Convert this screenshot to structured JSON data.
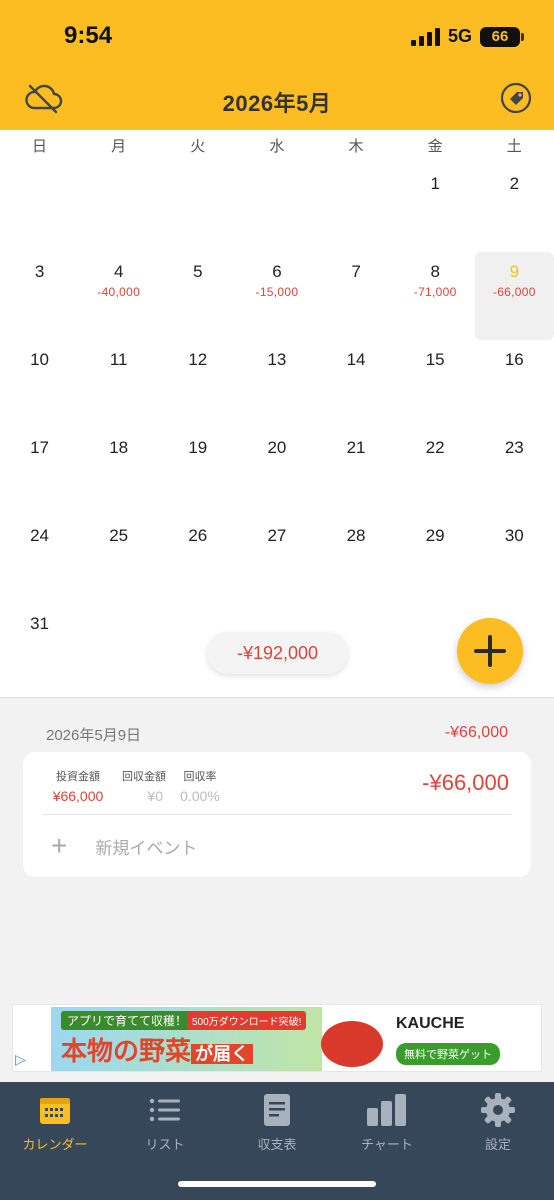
{
  "status": {
    "time": "9:54",
    "network": "5G",
    "battery": "66"
  },
  "header": {
    "title": "2026年5月",
    "left_icon": "cloud-off-icon",
    "right_icon": "tag-icon"
  },
  "calendar": {
    "weekdays": [
      "日",
      "月",
      "火",
      "水",
      "木",
      "金",
      "土"
    ],
    "days": [
      {
        "day": ""
      },
      {
        "day": ""
      },
      {
        "day": ""
      },
      {
        "day": ""
      },
      {
        "day": ""
      },
      {
        "day": "1"
      },
      {
        "day": "2"
      },
      {
        "day": "3"
      },
      {
        "day": "4",
        "amount": "-40,000"
      },
      {
        "day": "5"
      },
      {
        "day": "6",
        "amount": "-15,000"
      },
      {
        "day": "7"
      },
      {
        "day": "8",
        "amount": "-71,000"
      },
      {
        "day": "9",
        "amount": "-66,000",
        "selected": true
      },
      {
        "day": "10"
      },
      {
        "day": "11"
      },
      {
        "day": "12"
      },
      {
        "day": "13"
      },
      {
        "day": "14"
      },
      {
        "day": "15"
      },
      {
        "day": "16"
      },
      {
        "day": "17"
      },
      {
        "day": "18"
      },
      {
        "day": "19"
      },
      {
        "day": "20"
      },
      {
        "day": "21"
      },
      {
        "day": "22"
      },
      {
        "day": "23"
      },
      {
        "day": "24"
      },
      {
        "day": "25"
      },
      {
        "day": "26"
      },
      {
        "day": "27"
      },
      {
        "day": "28"
      },
      {
        "day": "29"
      },
      {
        "day": "30"
      },
      {
        "day": "31"
      }
    ],
    "month_total": "-¥192,000"
  },
  "selected_day": {
    "date": "2026年5月9日",
    "total": "-¥66,000",
    "card": {
      "invest_label": "投資金額",
      "invest_value": "¥66,000",
      "recover_label": "回収金額",
      "recover_value": "¥0",
      "rate_label": "回収率",
      "rate_value": "0.00%",
      "amount": "-¥66,000"
    },
    "new_event_label": "新規イベント"
  },
  "ad": {
    "top_text": "アプリで育てて収穫！",
    "badge": "500万ダウンロード突破!",
    "main_text": "本物の野菜",
    "main_suffix": "が届く",
    "brand": "KAUCHE",
    "cta": "無料で野菜ゲット"
  },
  "tabs": [
    {
      "label": "カレンダー",
      "icon": "calendar-icon",
      "active": true
    },
    {
      "label": "リスト",
      "icon": "list-icon"
    },
    {
      "label": "収支表",
      "icon": "document-icon"
    },
    {
      "label": "チャート",
      "icon": "bar-chart-icon"
    },
    {
      "label": "設定",
      "icon": "gear-icon"
    }
  ],
  "colors": {
    "accent": "#fbbd22",
    "negative": "#e0433a",
    "tabbar": "#37475a"
  }
}
